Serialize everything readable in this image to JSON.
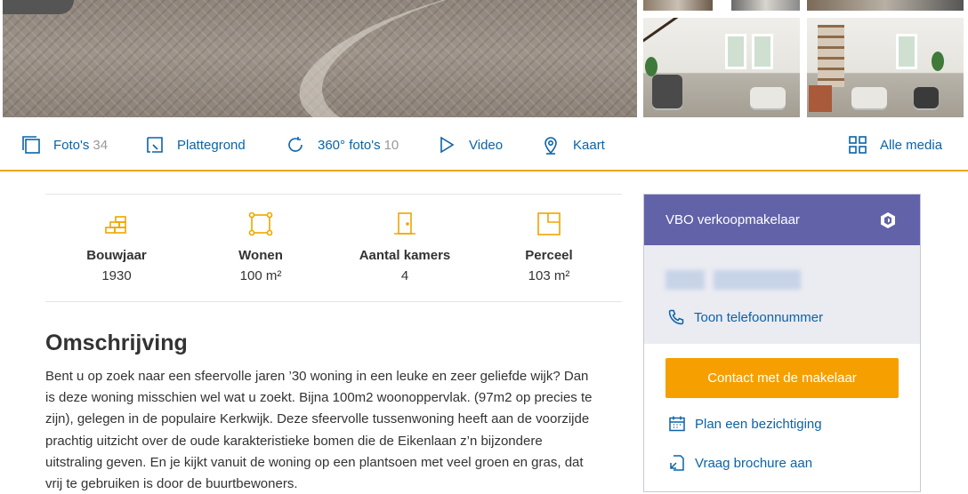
{
  "media_bar": {
    "photos_label": "Foto's",
    "photos_count": "34",
    "floorplan_label": "Plattegrond",
    "photos360_label": "360° foto's",
    "photos360_count": "10",
    "video_label": "Video",
    "map_label": "Kaart",
    "all_media_label": "Alle media"
  },
  "features": [
    {
      "label": "Bouwjaar",
      "value": "1930",
      "icon": "bricks-icon"
    },
    {
      "label": "Wonen",
      "value": "100 m²",
      "icon": "area-icon"
    },
    {
      "label": "Aantal kamers",
      "value": "4",
      "icon": "door-icon"
    },
    {
      "label": "Perceel",
      "value": "103 m²",
      "icon": "plot-icon"
    }
  ],
  "description": {
    "title": "Omschrijving",
    "lines": [
      "Bent u op zoek naar een sfeervolle jaren ’30 woning in een leuke en zeer geliefde wijk? Dan",
      "is deze woning misschien wel wat u zoekt. Bijna 100m2 woonoppervlak. (97m2 op precies te",
      "zijn), gelegen in de populaire Kerkwijk. Deze sfeervolle tussenwoning heeft aan de voorzijde",
      "prachtig uitzicht over de oude karakteristieke bomen die de Eikenlaan z’n bijzondere",
      "uitstraling geven. En je kijkt vanuit de woning op een plantsoen met veel groen en gras, dat",
      "vrij te gebruiken is door de buurtbewoners."
    ]
  },
  "agent": {
    "header": "VBO verkoopmakelaar",
    "phone_label": "Toon telefoonnummer",
    "contact_button": "Contact met de makelaar",
    "viewing_label": "Plan een bezichtiging",
    "brochure_label": "Vraag brochure aan"
  },
  "colors": {
    "accent": "#f0a500",
    "link": "#0a63a8",
    "agent_header": "#6262a9",
    "agent_info_bg": "#ebebf2"
  }
}
